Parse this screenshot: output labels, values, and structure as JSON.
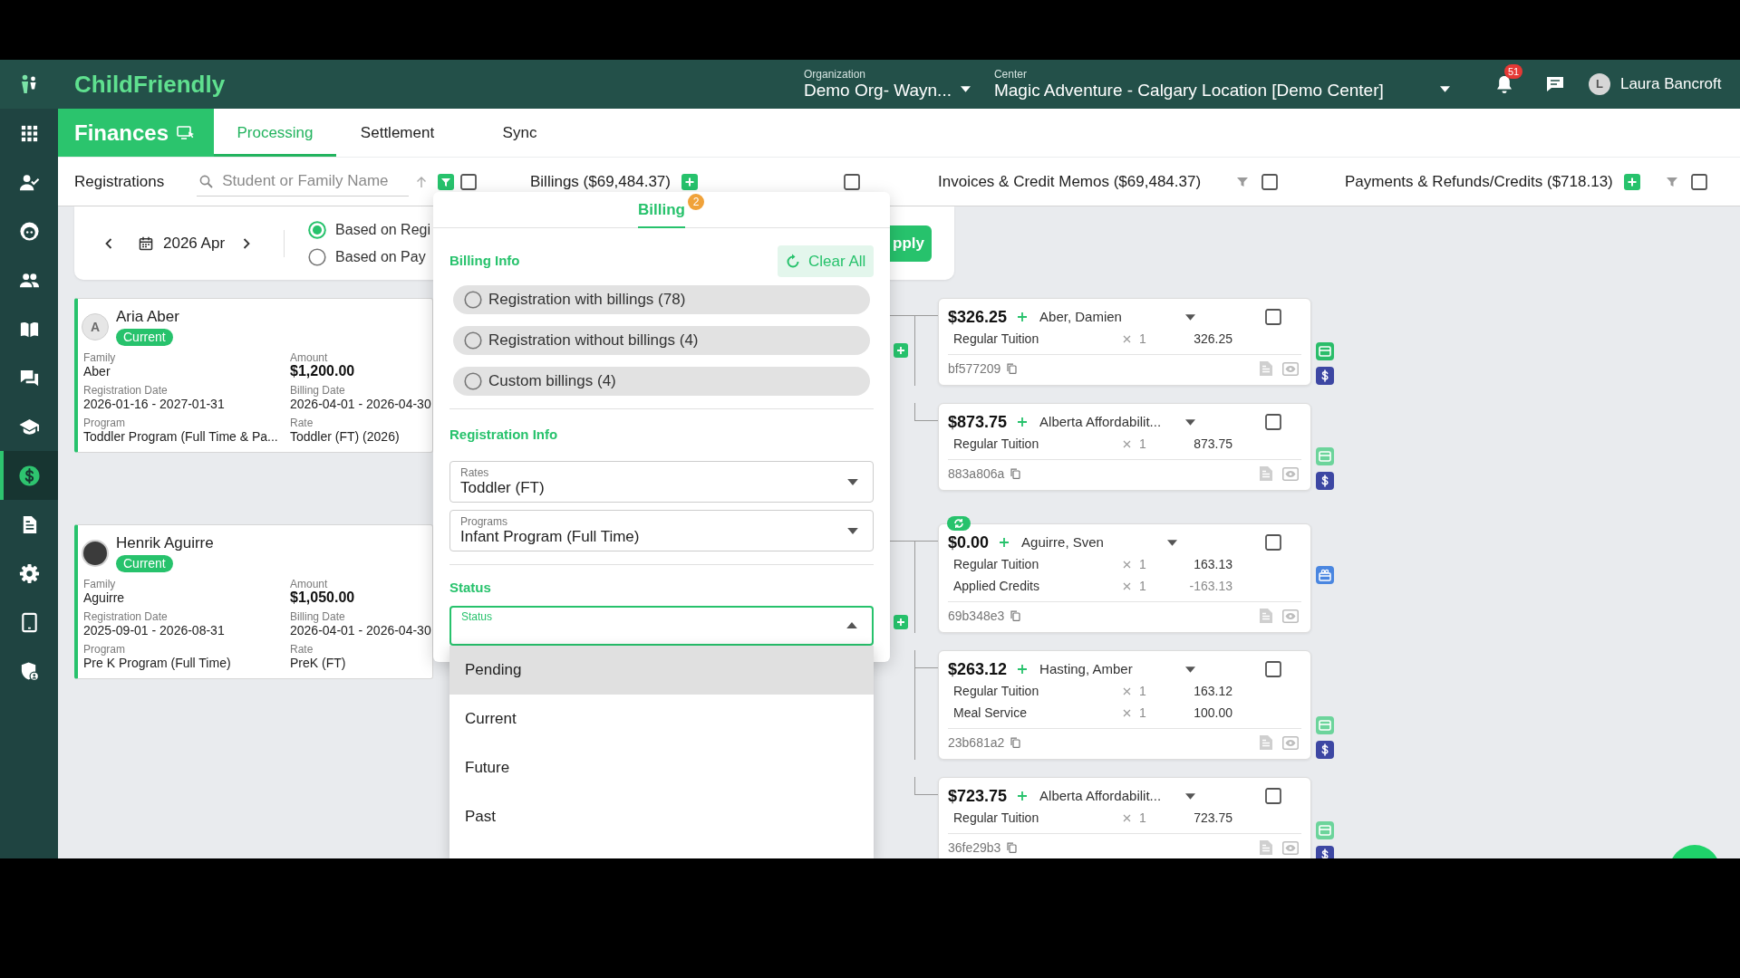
{
  "header": {
    "logo_text": "ChildFriendly",
    "organization": {
      "label": "Organization",
      "value": "Demo Org- Wayn..."
    },
    "center": {
      "label": "Center",
      "value": "Magic Adventure - Calgary Location [Demo Center]"
    },
    "notification_count": "51",
    "user": {
      "initial": "L",
      "name": "Laura Bancroft"
    }
  },
  "sidebar": {
    "items": [
      {
        "selected": false
      },
      {
        "selected": false
      },
      {
        "selected": false
      },
      {
        "selected": false
      },
      {
        "selected": false
      },
      {
        "selected": false
      },
      {
        "selected": false
      },
      {
        "selected": true
      },
      {
        "selected": false
      },
      {
        "selected": false
      },
      {
        "selected": false
      },
      {
        "selected": false
      }
    ]
  },
  "module": {
    "title": "Finances"
  },
  "tabs": [
    {
      "label": "Processing",
      "selected": true
    },
    {
      "label": "Settlement",
      "selected": false
    },
    {
      "label": "Sync",
      "selected": false
    }
  ],
  "toolbar": {
    "panels": [
      {
        "title": "Registrations",
        "search_placeholder": "Student or Family Name",
        "sort": true,
        "filter": {
          "active": true
        },
        "checked": false
      },
      {
        "title": "Billings ($69,484.37)",
        "add": true,
        "checked": false
      },
      {
        "title": "Invoices & Credit Memos ($69,484.37)",
        "filter": {
          "active": false
        },
        "checked": false
      },
      {
        "title": "Payments & Refunds/Credits ($718.13)",
        "add": true,
        "filter": {
          "active": false
        },
        "checked": false
      }
    ]
  },
  "period": {
    "month": "2026 Apr",
    "options": [
      {
        "label": "Based on Regi",
        "selected": true
      },
      {
        "label": "Based on Pay",
        "selected": false
      }
    ],
    "apply_label": "pply"
  },
  "registrations": [
    {
      "name": "Aria Aber",
      "avatar": {
        "kind": "initial",
        "initial": "A"
      },
      "status": "Current",
      "fields": [
        {
          "label": "Family",
          "value": "Aber",
          "kind": "text"
        },
        {
          "label": "Amount",
          "value": "$1,200.00",
          "kind": "amount"
        },
        {
          "label": "Registration Date",
          "value": "2026-01-16 - 2027-01-31",
          "kind": "text"
        },
        {
          "label": "Billing Date",
          "value": "2026-04-01 - 2026-04-30",
          "kind": "text"
        },
        {
          "label": "Program",
          "value": "Toddler Program (Full Time & Pa...",
          "kind": "text"
        },
        {
          "label": "Rate",
          "value": "Toddler (FT) (2026)",
          "kind": "text"
        }
      ]
    },
    {
      "name": "Henrik Aguirre",
      "avatar": {
        "kind": "photo"
      },
      "status": "Current",
      "fields": [
        {
          "label": "Family",
          "value": "Aguirre",
          "kind": "text"
        },
        {
          "label": "Amount",
          "value": "$1,050.00",
          "kind": "amount"
        },
        {
          "label": "Registration Date",
          "value": "2025-09-01 - 2026-08-31",
          "kind": "text"
        },
        {
          "label": "Billing Date",
          "value": "2026-04-01 - 2026-04-30",
          "kind": "text"
        },
        {
          "label": "Program",
          "value": "Pre K Program (Full Time)",
          "kind": "text"
        },
        {
          "label": "Rate",
          "value": "PreK (FT)",
          "kind": "text"
        }
      ]
    }
  ],
  "billing_groups": [
    {
      "cards": [
        {
          "amount": "$326.25",
          "payer": "Aber, Damien",
          "checked": false,
          "sync_badge": false,
          "lines": [
            {
              "item": "Regular Tuition",
              "qty": "1",
              "amount": "326.25",
              "kind": "charge"
            }
          ],
          "ref": "bf577209",
          "side_icons": [
            {
              "kind": "card",
              "color": "#2bbd6a"
            },
            {
              "kind": "dollar",
              "color": "#3d47a3"
            }
          ]
        },
        {
          "amount": "$873.75",
          "payer": "Alberta Affordabilit...",
          "checked": false,
          "sync_badge": false,
          "lines": [
            {
              "item": "Regular Tuition",
              "qty": "1",
              "amount": "873.75",
              "kind": "charge"
            }
          ],
          "ref": "883a806a",
          "side_icons": [
            {
              "kind": "card",
              "color": "#6cd49b"
            },
            {
              "kind": "dollar",
              "color": "#3d47a3"
            }
          ]
        }
      ]
    },
    {
      "cards": [
        {
          "amount": "$0.00",
          "payer": "Aguirre, Sven",
          "checked": false,
          "sync_badge": true,
          "lines": [
            {
              "item": "Regular Tuition",
              "qty": "1",
              "amount": "163.13",
              "kind": "charge"
            },
            {
              "item": "Applied Credits",
              "qty": "1",
              "amount": "-163.13",
              "kind": "credit"
            }
          ],
          "ref": "69b348e3",
          "side_icons": [
            {
              "kind": "gift",
              "color": "#4a86e0"
            }
          ]
        },
        {
          "amount": "$263.12",
          "payer": "Hasting, Amber",
          "checked": false,
          "sync_badge": false,
          "lines": [
            {
              "item": "Regular Tuition",
              "qty": "1",
              "amount": "163.12",
              "kind": "charge"
            },
            {
              "item": "Meal Service",
              "qty": "1",
              "amount": "100.00",
              "kind": "charge"
            }
          ],
          "ref": "23b681a2",
          "side_icons": [
            {
              "kind": "card",
              "color": "#6cd49b"
            },
            {
              "kind": "dollar",
              "color": "#3d47a3"
            }
          ]
        },
        {
          "amount": "$723.75",
          "payer": "Alberta Affordabilit...",
          "checked": false,
          "sync_badge": false,
          "lines": [
            {
              "item": "Regular Tuition",
              "qty": "1",
              "amount": "723.75",
              "kind": "charge"
            }
          ],
          "ref": "36fe29b3",
          "side_icons": [
            {
              "kind": "card",
              "color": "#6cd49b"
            },
            {
              "kind": "dollar",
              "color": "#3d47a3"
            }
          ]
        }
      ]
    }
  ],
  "filter_popup": {
    "tab": {
      "label": "Billing",
      "badge": "2",
      "selected": true
    },
    "billing_info": {
      "title": "Billing Info",
      "clear_label": "Clear All",
      "options": [
        {
          "label": "Registration with billings (78)",
          "selected": false
        },
        {
          "label": "Registration without billings (4)",
          "selected": false
        },
        {
          "label": "Custom billings (4)",
          "selected": false
        }
      ]
    },
    "registration_info": {
      "title": "Registration Info",
      "selects": [
        {
          "label": "Rates",
          "value": "Toddler (FT)"
        },
        {
          "label": "Programs",
          "value": "Infant Program (Full Time)"
        }
      ]
    },
    "status": {
      "title": "Status",
      "field": {
        "label": "Status",
        "focused": true,
        "expanded": true
      },
      "options": [
        {
          "label": "Pending",
          "highlighted": true
        },
        {
          "label": "Current",
          "highlighted": false
        },
        {
          "label": "Future",
          "highlighted": false
        },
        {
          "label": "Past",
          "highlighted": false
        }
      ]
    }
  }
}
